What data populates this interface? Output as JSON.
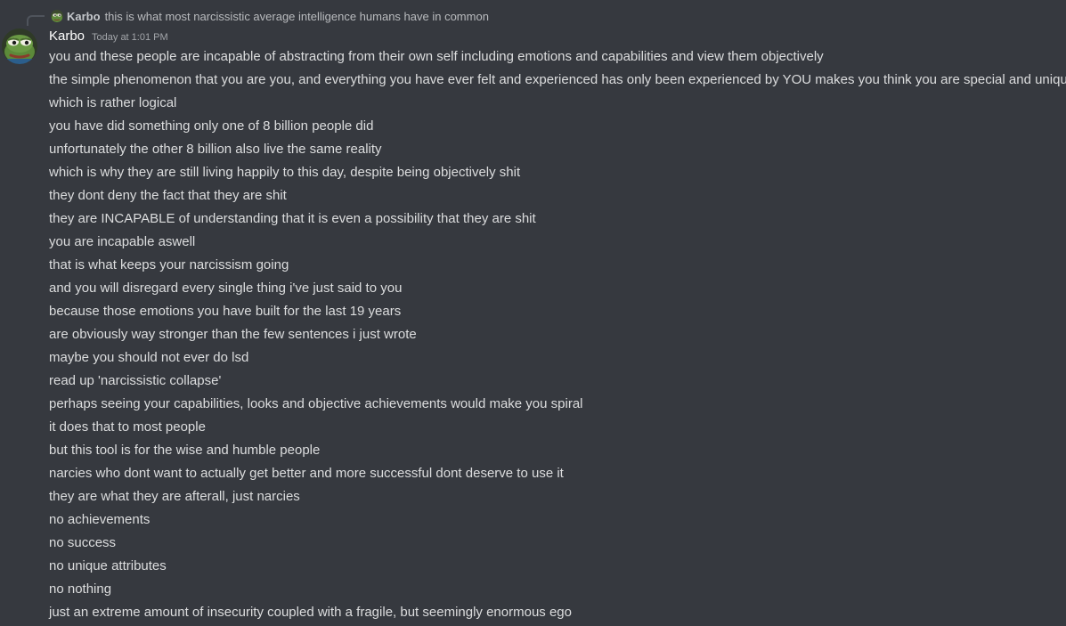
{
  "reply": {
    "author": "Karbo",
    "text": "this is what most narcissistic average intelligence humans have in common",
    "avatar_icon": "pepe-frog-avatar-icon"
  },
  "message": {
    "author": "Karbo",
    "timestamp": "Today at 1:01 PM",
    "avatar_icon": "pepe-frog-avatar-icon",
    "lines": [
      "you and these people are incapable of abstracting from their own self including emotions and capabilities and view them objectively",
      "the simple phenomenon that you are you, and everything you have ever felt and experienced has only been experienced by YOU makes you think you are special and unique",
      "which is rather logical",
      "you have did something only one of 8 billion people did",
      "unfortunately the other 8 billion also live the same reality",
      "which is why they are still living happily to this day, despite being objectively shit",
      "they dont deny the fact that they are shit",
      "they are INCAPABLE of understanding that it is even a possibility that they are shit",
      "you are incapable aswell",
      "that is what keeps your narcissism going",
      "and you will disregard every single thing i've just said to you",
      "because those emotions you have built for the last 19 years",
      "are obviously way stronger than the few sentences i just wrote",
      "maybe you should not ever do lsd",
      "read up 'narcissistic collapse'",
      "perhaps seeing your capabilities, looks and objective achievements would make you spiral",
      "it does that to most people",
      "but this tool is for the wise and humble people",
      "narcies who dont want to actually get better and more successful dont deserve to use it",
      "they are what they are afterall, just narcies",
      "no achievements",
      "no success",
      "no unique attributes",
      "no nothing",
      "just an extreme amount of insecurity coupled with a fragile, but seemingly enormous ego"
    ]
  },
  "colors": {
    "background": "#36393f",
    "text": "#dcddde",
    "username": "#ffffff",
    "muted": "#a3a6aa"
  }
}
